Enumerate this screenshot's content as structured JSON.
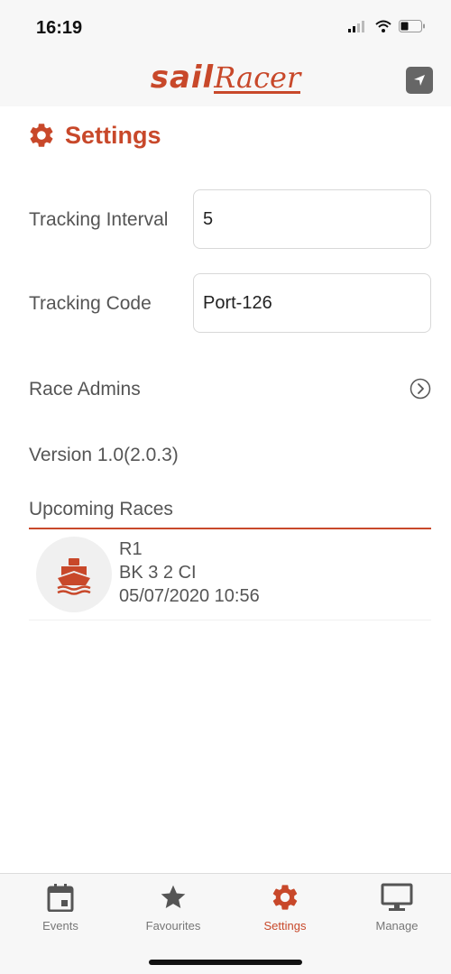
{
  "status_bar": {
    "time": "16:19",
    "icons": [
      "signal-icon",
      "wifi-icon",
      "battery-icon"
    ]
  },
  "header": {
    "logo_part1": "sail",
    "logo_part2": "Racer",
    "nav_icon": "location-arrow-icon"
  },
  "page": {
    "title": "Settings",
    "title_icon": "gear-icon"
  },
  "form": {
    "tracking_interval_label": "Tracking Interval",
    "tracking_interval_value": "5",
    "tracking_code_label": "Tracking Code",
    "tracking_code_value": "Port-126"
  },
  "rows": {
    "race_admins": "Race Admins",
    "version": "Version 1.0(2.0.3)"
  },
  "upcoming": {
    "title": "Upcoming Races",
    "races": [
      {
        "name": "R1",
        "boat": "BK 3 2 CI",
        "datetime": "05/07/2020 10:56",
        "icon": "boat-icon"
      }
    ]
  },
  "tabs": [
    {
      "label": "Events",
      "icon": "calendar-icon",
      "active": false
    },
    {
      "label": "Favourites",
      "icon": "star-icon",
      "active": false
    },
    {
      "label": "Settings",
      "icon": "gear-icon",
      "active": true
    },
    {
      "label": "Manage",
      "icon": "monitor-icon",
      "active": false
    }
  ],
  "colors": {
    "accent": "#c8482a",
    "icon_gray": "#555555"
  }
}
